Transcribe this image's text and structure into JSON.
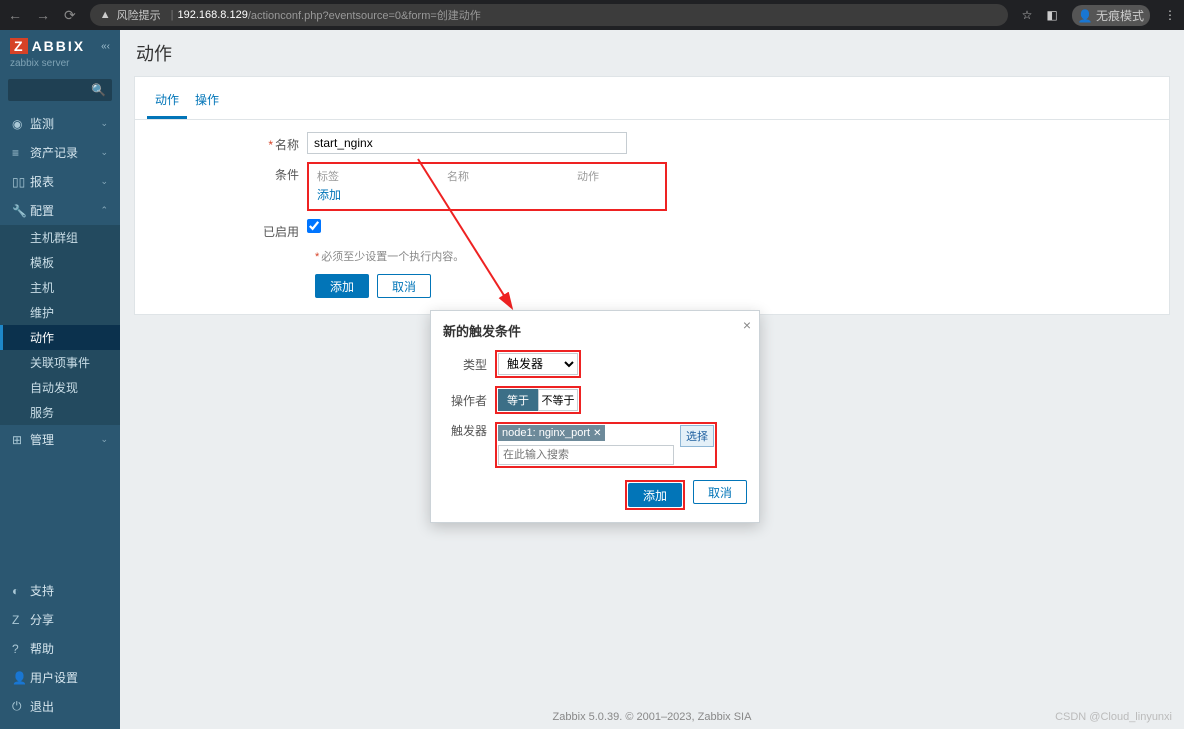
{
  "browser": {
    "warn": "风险提示",
    "url_host": "192.168.8.129",
    "url_path": "/actionconf.php?eventsource=0&form=创建动作",
    "incognito": "无痕模式"
  },
  "brand": {
    "mark": "Z",
    "text": "ABBIX",
    "server": "zabbix server"
  },
  "nav": {
    "monitor": "监测",
    "inventory": "资产记录",
    "reports": "报表",
    "config": "配置",
    "admin": "管理",
    "sub": {
      "hostgroups": "主机群组",
      "templates": "模板",
      "hosts": "主机",
      "maintenance": "维护",
      "actions": "动作",
      "correlation": "关联项事件",
      "discovery": "自动发现",
      "services": "服务"
    },
    "footer": {
      "support": "支持",
      "share": "分享",
      "help": "帮助",
      "usersettings": "用户设置",
      "signout": "退出"
    }
  },
  "page": {
    "title": "动作",
    "tabs": {
      "action": "动作",
      "operation": "操作"
    },
    "labels": {
      "name": "名称",
      "conditions": "条件",
      "enabled": "已启用"
    },
    "name_value": "start_nginx",
    "cond_head": {
      "label": "标签",
      "name": "名称",
      "action": "动作"
    },
    "cond_add": "添加",
    "note": "必须至少设置一个执行内容。",
    "btn_add": "添加",
    "btn_cancel": "取消"
  },
  "modal": {
    "title": "新的触发条件",
    "type_label": "类型",
    "type_value": "触发器",
    "operator_label": "操作者",
    "op_eq": "等于",
    "op_neq": "不等于",
    "trigger_label": "触发器",
    "trigger_tag": "node1: nginx_port",
    "trigger_placeholder": "在此输入搜索",
    "select": "选择",
    "add": "添加",
    "cancel": "取消"
  },
  "footer": "Zabbix 5.0.39. © 2001–2023, Zabbix SIA",
  "watermark": "CSDN @Cloud_linyunxi"
}
